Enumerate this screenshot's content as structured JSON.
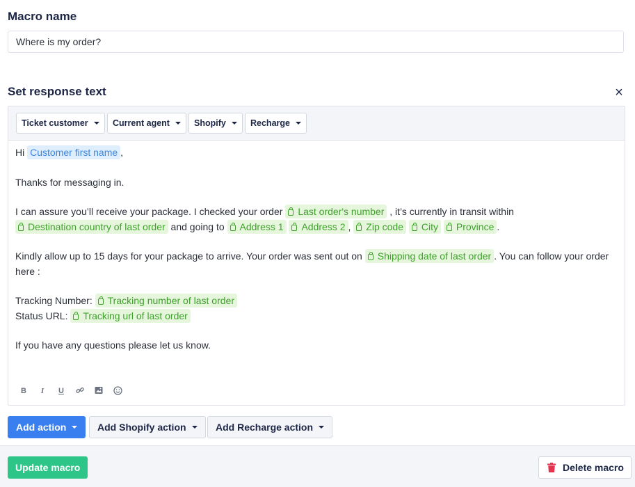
{
  "macro": {
    "name_label": "Macro name",
    "name_value": "Where is my order?"
  },
  "response": {
    "label": "Set response text",
    "close_icon": "close-icon",
    "toolbar": [
      "Ticket customer",
      "Current agent",
      "Shopify",
      "Recharge"
    ],
    "lines": {
      "greeting_pre": "Hi",
      "greeting_var": "Customer first name",
      "greeting_post": ",",
      "thanks": "Thanks for messaging in.",
      "p3_a": "I can assure you’ll receive your package. I checked your order",
      "var_last_order": "Last order's number",
      "p3_b": ", it’s currently in transit within",
      "var_dest_country": "Destination country of last order",
      "p3_c": "and going to",
      "var_address1": "Address 1",
      "var_address2": "Address 2",
      "comma": ",",
      "var_zip": "Zip code",
      "var_city": "City",
      "var_province": "Province",
      "period": ".",
      "p4_a": "Kindly allow up to 15 days for your package to arrive. Your order was sent out on",
      "var_ship_date": "Shipping date of last order",
      "p4_b": ". You can follow your order here :",
      "tracking_label": "Tracking Number:",
      "var_tracking_number": "Tracking number of last order",
      "status_label": "Status URL:",
      "var_tracking_url": "Tracking url of last order",
      "closing": "If you have any questions please let us know."
    },
    "format_icons": [
      "bold-icon",
      "italic-icon",
      "underline-icon",
      "link-icon",
      "image-icon",
      "emoji-icon"
    ]
  },
  "actions": {
    "add_action": "Add action",
    "add_shopify": "Add Shopify action",
    "add_recharge": "Add Recharge action"
  },
  "footer": {
    "update": "Update macro",
    "delete": "Delete macro"
  },
  "colors": {
    "primary": "#3a7ff0",
    "success": "#2dc688",
    "danger": "#e3344e",
    "shopify_green": "#3fa12b",
    "customer_blue": "#3e86dc"
  }
}
